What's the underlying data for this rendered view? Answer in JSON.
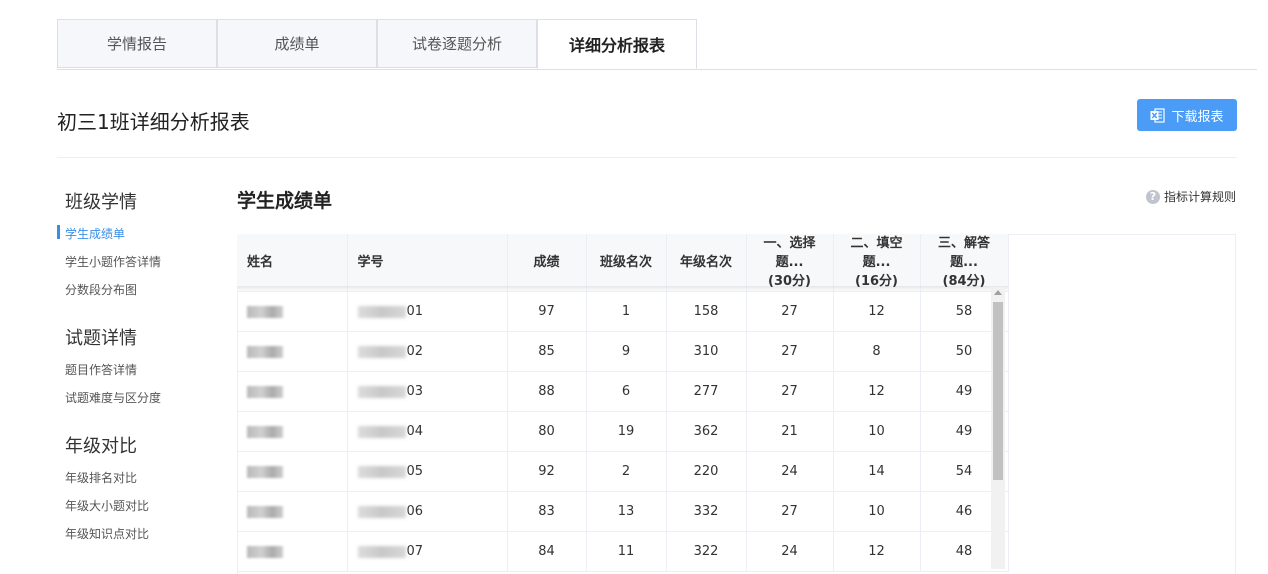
{
  "tabs": [
    {
      "label": "学情报告",
      "active": false
    },
    {
      "label": "成绩单",
      "active": false
    },
    {
      "label": "试卷逐题分析",
      "active": false
    },
    {
      "label": "详细分析报表",
      "active": true
    }
  ],
  "header": {
    "title": "初三1班详细分析报表",
    "download_label": "下载报表"
  },
  "sidebar": {
    "groups": [
      {
        "title": "班级学情",
        "items": [
          "学生成绩单",
          "学生小题作答详情",
          "分数段分布图"
        ]
      },
      {
        "title": "试题详情",
        "items": [
          "题目作答详情",
          "试题难度与区分度"
        ]
      },
      {
        "title": "年级对比",
        "items": [
          "年级排名对比",
          "年级大小题对比",
          "年级知识点对比"
        ]
      }
    ],
    "active_item": "学生成绩单"
  },
  "section": {
    "title": "学生成绩单",
    "rules_label": "指标计算规则",
    "help_glyph": "?"
  },
  "table": {
    "columns": [
      {
        "line1": "姓名",
        "line2": ""
      },
      {
        "line1": "学号",
        "line2": ""
      },
      {
        "line1": "成绩",
        "line2": ""
      },
      {
        "line1": "班级名次",
        "line2": ""
      },
      {
        "line1": "年级名次",
        "line2": ""
      },
      {
        "line1": "一、选择题...",
        "line2": "(30分)"
      },
      {
        "line1": "二、填空题...",
        "line2": "(16分)"
      },
      {
        "line1": "三、解答题...",
        "line2": "(84分)"
      }
    ],
    "rows": [
      {
        "id_tail": "01",
        "score": "97",
        "class_rank": "1",
        "grade_rank": "158",
        "q1": "27",
        "q2": "12",
        "q3": "58"
      },
      {
        "id_tail": "02",
        "score": "85",
        "class_rank": "9",
        "grade_rank": "310",
        "q1": "27",
        "q2": "8",
        "q3": "50"
      },
      {
        "id_tail": "03",
        "score": "88",
        "class_rank": "6",
        "grade_rank": "277",
        "q1": "27",
        "q2": "12",
        "q3": "49"
      },
      {
        "id_tail": "04",
        "score": "80",
        "class_rank": "19",
        "grade_rank": "362",
        "q1": "21",
        "q2": "10",
        "q3": "49"
      },
      {
        "id_tail": "05",
        "score": "92",
        "class_rank": "2",
        "grade_rank": "220",
        "q1": "24",
        "q2": "14",
        "q3": "54"
      },
      {
        "id_tail": "06",
        "score": "83",
        "class_rank": "13",
        "grade_rank": "332",
        "q1": "27",
        "q2": "10",
        "q3": "46"
      },
      {
        "id_tail": "07",
        "score": "84",
        "class_rank": "11",
        "grade_rank": "322",
        "q1": "24",
        "q2": "12",
        "q3": "48"
      }
    ]
  },
  "colors": {
    "accent": "#3a8ee6",
    "download_button": "#4a9cf6"
  },
  "icons": {
    "download": "excel-icon",
    "help": "question-circle-icon"
  }
}
